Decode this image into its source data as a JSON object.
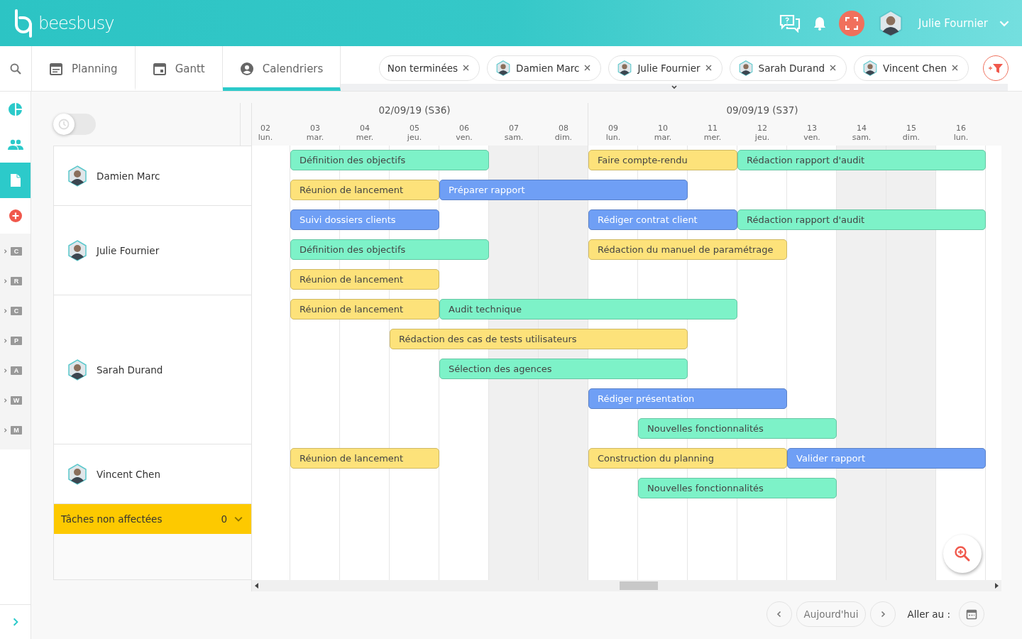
{
  "header": {
    "brand": "beesbusy",
    "user": "Julie Fournier"
  },
  "tabs": [
    {
      "label": "Planning",
      "selected": false
    },
    {
      "label": "Gantt",
      "selected": false
    },
    {
      "label": "Calendriers",
      "selected": true
    }
  ],
  "filters": [
    {
      "label": "Non terminées",
      "avatar": false
    },
    {
      "label": "Damien Marc",
      "avatar": true
    },
    {
      "label": "Julie Fournier",
      "avatar": true
    },
    {
      "label": "Sarah Durand",
      "avatar": true
    },
    {
      "label": "Vincent Chen",
      "avatar": true
    }
  ],
  "sidebar": {
    "items": [
      {
        "selected": false
      },
      {
        "selected": false
      },
      {
        "selected": true
      },
      {
        "selected": false
      }
    ],
    "folders": [
      "C",
      "R",
      "C",
      "P",
      "A",
      "W",
      "M"
    ]
  },
  "toggle": {
    "on": false
  },
  "weeks": [
    "02/09/19 (S36)",
    "09/09/19 (S37)"
  ],
  "days": [
    {
      "date": "02",
      "weekday": "lun.",
      "weekend": false
    },
    {
      "date": "03",
      "weekday": "mar.",
      "weekend": false
    },
    {
      "date": "04",
      "weekday": "mer.",
      "weekend": false
    },
    {
      "date": "05",
      "weekday": "jeu.",
      "weekend": false
    },
    {
      "date": "06",
      "weekday": "ven.",
      "weekend": false
    },
    {
      "date": "07",
      "weekday": "sam.",
      "weekend": true
    },
    {
      "date": "08",
      "weekday": "dim.",
      "weekend": true
    },
    {
      "date": "09",
      "weekday": "lun.",
      "weekend": false
    },
    {
      "date": "10",
      "weekday": "mar.",
      "weekend": false
    },
    {
      "date": "11",
      "weekday": "mer.",
      "weekend": false
    },
    {
      "date": "12",
      "weekday": "jeu.",
      "weekend": false
    },
    {
      "date": "13",
      "weekday": "ven.",
      "weekend": false
    },
    {
      "date": "14",
      "weekday": "sam.",
      "weekend": true
    },
    {
      "date": "15",
      "weekday": "dim.",
      "weekend": true
    },
    {
      "date": "16",
      "weekday": "lun.",
      "weekend": false
    }
  ],
  "resources": [
    {
      "name": "Damien Marc",
      "lanes": [
        [
          {
            "kind": "free"
          },
          {
            "kind": "task",
            "title": "Définition des objectifs",
            "color": "#7df2c8"
          },
          {
            "kind": "continued"
          },
          {
            "kind": "continued"
          },
          {
            "kind": "continued"
          },
          {
            "kind": "free"
          },
          {
            "kind": "free"
          },
          {
            "kind": "task",
            "title": "Faire compte-rendu",
            "color": "#fde27a"
          },
          {
            "kind": "continued"
          },
          {
            "kind": "continued"
          },
          {
            "kind": "task",
            "title": "Rédaction rapport d'audit",
            "color": "#7df2c8"
          },
          {
            "kind": "continued"
          },
          {
            "kind": "continued"
          },
          {
            "kind": "continued"
          },
          {
            "kind": "continued"
          }
        ],
        [
          {
            "kind": "free"
          },
          {
            "kind": "task",
            "title": "Réunion de lancement",
            "color": "#fde27a"
          },
          {
            "kind": "continued"
          },
          {
            "kind": "continued"
          },
          {
            "kind": "task",
            "title": "Préparer rapport",
            "color": "#6f9ff5"
          },
          {
            "kind": "continued"
          },
          {
            "kind": "continued"
          },
          {
            "kind": "continued"
          },
          {
            "kind": "continued"
          },
          {
            "kind": "free"
          },
          {
            "kind": "free"
          },
          {
            "kind": "free"
          },
          {
            "kind": "free"
          },
          {
            "kind": "free"
          },
          {
            "kind": "free"
          }
        ]
      ]
    },
    {
      "name": "Julie Fournier",
      "lanes": [
        [
          {
            "kind": "free"
          },
          {
            "kind": "task",
            "title": "Suivi dossiers clients",
            "color": "#6f9ff5"
          },
          {
            "kind": "continued"
          },
          {
            "kind": "continued"
          },
          {
            "kind": "free"
          },
          {
            "kind": "free"
          },
          {
            "kind": "free"
          },
          {
            "kind": "task",
            "title": "Rédiger contrat client",
            "color": "#6f9ff5"
          },
          {
            "kind": "continued"
          },
          {
            "kind": "continued"
          },
          {
            "kind": "task",
            "title": "Rédaction rapport d'audit",
            "color": "#7df2c8"
          },
          {
            "kind": "continued"
          },
          {
            "kind": "continued"
          },
          {
            "kind": "continued"
          },
          {
            "kind": "continued"
          }
        ],
        [
          {
            "kind": "free"
          },
          {
            "kind": "task",
            "title": "Définition des objectifs",
            "color": "#7df2c8"
          },
          {
            "kind": "continued"
          },
          {
            "kind": "continued"
          },
          {
            "kind": "continued"
          },
          {
            "kind": "free"
          },
          {
            "kind": "free"
          },
          {
            "kind": "task",
            "title": "Rédaction du manuel de paramétrage",
            "color": "#fde27a"
          },
          {
            "kind": "continued"
          },
          {
            "kind": "continued"
          },
          {
            "kind": "continued"
          },
          {
            "kind": "free"
          },
          {
            "kind": "free"
          },
          {
            "kind": "free"
          },
          {
            "kind": "free"
          }
        ],
        [
          {
            "kind": "free"
          },
          {
            "kind": "task",
            "title": "Réunion de lancement",
            "color": "#fde27a"
          },
          {
            "kind": "continued"
          },
          {
            "kind": "continued"
          },
          {
            "kind": "free"
          },
          {
            "kind": "free"
          },
          {
            "kind": "free"
          },
          {
            "kind": "free"
          },
          {
            "kind": "free"
          },
          {
            "kind": "free"
          },
          {
            "kind": "free"
          },
          {
            "kind": "free"
          },
          {
            "kind": "free"
          },
          {
            "kind": "free"
          },
          {
            "kind": "free"
          }
        ]
      ]
    },
    {
      "name": "Sarah Durand",
      "lanes": [
        [
          {
            "kind": "free"
          },
          {
            "kind": "task",
            "title": "Réunion de lancement",
            "color": "#fde27a"
          },
          {
            "kind": "continued"
          },
          {
            "kind": "continued"
          },
          {
            "kind": "task",
            "title": "Audit technique",
            "color": "#7df2c8"
          },
          {
            "kind": "continued"
          },
          {
            "kind": "continued"
          },
          {
            "kind": "continued"
          },
          {
            "kind": "continued"
          },
          {
            "kind": "continued"
          },
          {
            "kind": "free"
          },
          {
            "kind": "free"
          },
          {
            "kind": "free"
          },
          {
            "kind": "free"
          },
          {
            "kind": "free"
          }
        ],
        [
          {
            "kind": "free"
          },
          {
            "kind": "free"
          },
          {
            "kind": "free"
          },
          {
            "kind": "task",
            "title": "Rédaction des cas de tests utilisateurs",
            "color": "#fde27a"
          },
          {
            "kind": "continued"
          },
          {
            "kind": "continued"
          },
          {
            "kind": "continued"
          },
          {
            "kind": "continued"
          },
          {
            "kind": "continued"
          },
          {
            "kind": "free"
          },
          {
            "kind": "free"
          },
          {
            "kind": "free"
          },
          {
            "kind": "free"
          },
          {
            "kind": "free"
          },
          {
            "kind": "free"
          }
        ],
        [
          {
            "kind": "free"
          },
          {
            "kind": "free"
          },
          {
            "kind": "free"
          },
          {
            "kind": "free"
          },
          {
            "kind": "task",
            "title": "Sélection des agences",
            "color": "#7df2c8"
          },
          {
            "kind": "continued"
          },
          {
            "kind": "continued"
          },
          {
            "kind": "continued"
          },
          {
            "kind": "continued"
          },
          {
            "kind": "free"
          },
          {
            "kind": "free"
          },
          {
            "kind": "free"
          },
          {
            "kind": "free"
          },
          {
            "kind": "free"
          },
          {
            "kind": "free"
          }
        ],
        [
          {
            "kind": "free"
          },
          {
            "kind": "free"
          },
          {
            "kind": "free"
          },
          {
            "kind": "free"
          },
          {
            "kind": "free"
          },
          {
            "kind": "free"
          },
          {
            "kind": "free"
          },
          {
            "kind": "task",
            "title": "Rédiger présentation",
            "color": "#6f9ff5"
          },
          {
            "kind": "continued"
          },
          {
            "kind": "continued"
          },
          {
            "kind": "continued"
          },
          {
            "kind": "free"
          },
          {
            "kind": "free"
          },
          {
            "kind": "free"
          },
          {
            "kind": "free"
          }
        ],
        [
          {
            "kind": "free"
          },
          {
            "kind": "free"
          },
          {
            "kind": "free"
          },
          {
            "kind": "free"
          },
          {
            "kind": "free"
          },
          {
            "kind": "free"
          },
          {
            "kind": "free"
          },
          {
            "kind": "free"
          },
          {
            "kind": "task",
            "title": "Nouvelles fonctionnalités",
            "color": "#7df2c8"
          },
          {
            "kind": "continued"
          },
          {
            "kind": "continued"
          },
          {
            "kind": "continued"
          },
          {
            "kind": "free"
          },
          {
            "kind": "free"
          },
          {
            "kind": "free"
          }
        ]
      ]
    },
    {
      "name": "Vincent Chen",
      "lanes": [
        [
          {
            "kind": "free"
          },
          {
            "kind": "task",
            "title": "Réunion de lancement",
            "color": "#fde27a"
          },
          {
            "kind": "continued"
          },
          {
            "kind": "continued"
          },
          {
            "kind": "free"
          },
          {
            "kind": "free"
          },
          {
            "kind": "free"
          },
          {
            "kind": "task",
            "title": "Construction du planning",
            "color": "#fde27a"
          },
          {
            "kind": "continued"
          },
          {
            "kind": "continued"
          },
          {
            "kind": "continued"
          },
          {
            "kind": "task",
            "title": "Valider rapport",
            "color": "#6f9ff5"
          },
          {
            "kind": "continued"
          },
          {
            "kind": "continued"
          },
          {
            "kind": "continued"
          }
        ],
        [
          {
            "kind": "free"
          },
          {
            "kind": "free"
          },
          {
            "kind": "free"
          },
          {
            "kind": "free"
          },
          {
            "kind": "free"
          },
          {
            "kind": "free"
          },
          {
            "kind": "free"
          },
          {
            "kind": "free"
          },
          {
            "kind": "task",
            "title": "Nouvelles fonctionnalités",
            "color": "#7df2c8"
          },
          {
            "kind": "continued"
          },
          {
            "kind": "continued"
          },
          {
            "kind": "continued"
          },
          {
            "kind": "free"
          },
          {
            "kind": "free"
          },
          {
            "kind": "free"
          }
        ]
      ]
    }
  ],
  "unassigned": {
    "label": "Tâches non affectées",
    "count": "0"
  },
  "footer": {
    "today": "Aujourd'hui",
    "goto": "Aller au :"
  }
}
